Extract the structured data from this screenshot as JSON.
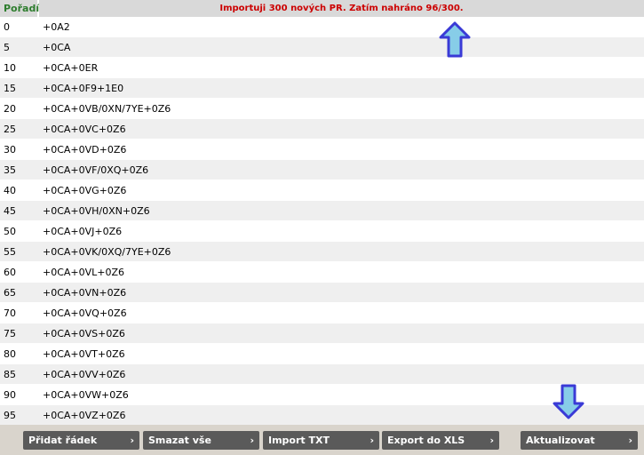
{
  "header": {
    "order_label": "Pořadí",
    "status": "Importuji 300 nových PR. Zatím nahráno 96/300."
  },
  "rows": [
    {
      "order": "0",
      "value": "+0A2"
    },
    {
      "order": "5",
      "value": "+0CA"
    },
    {
      "order": "10",
      "value": "+0CA+0ER"
    },
    {
      "order": "15",
      "value": "+0CA+0F9+1E0"
    },
    {
      "order": "20",
      "value": "+0CA+0VB/0XN/7YE+0Z6"
    },
    {
      "order": "25",
      "value": "+0CA+0VC+0Z6"
    },
    {
      "order": "30",
      "value": "+0CA+0VD+0Z6"
    },
    {
      "order": "35",
      "value": "+0CA+0VF/0XQ+0Z6"
    },
    {
      "order": "40",
      "value": "+0CA+0VG+0Z6"
    },
    {
      "order": "45",
      "value": "+0CA+0VH/0XN+0Z6"
    },
    {
      "order": "50",
      "value": "+0CA+0VJ+0Z6"
    },
    {
      "order": "55",
      "value": "+0CA+0VK/0XQ/7YE+0Z6"
    },
    {
      "order": "60",
      "value": "+0CA+0VL+0Z6"
    },
    {
      "order": "65",
      "value": "+0CA+0VN+0Z6"
    },
    {
      "order": "70",
      "value": "+0CA+0VQ+0Z6"
    },
    {
      "order": "75",
      "value": "+0CA+0VS+0Z6"
    },
    {
      "order": "80",
      "value": "+0CA+0VT+0Z6"
    },
    {
      "order": "85",
      "value": "+0CA+0VV+0Z6"
    },
    {
      "order": "90",
      "value": "+0CA+0VW+0Z6"
    },
    {
      "order": "95",
      "value": "+0CA+0VZ+0Z6"
    }
  ],
  "footer": {
    "add_row": "Přidat řádek",
    "delete_all": "Smazat vše",
    "import_txt": "Import TXT",
    "export_xls": "Export do XLS",
    "refresh": "Aktualizovat",
    "chevron": "›"
  },
  "icons": {
    "annotation_arrow_up": "arrow-up-icon",
    "annotation_arrow_down": "arrow-down-icon"
  },
  "colors": {
    "status_text": "#cc0000",
    "order_header_text": "#2e7d2e",
    "arrow_fill": "#87cde8",
    "arrow_stroke": "#3a3ad6",
    "button_bg": "#5a5a5a"
  }
}
